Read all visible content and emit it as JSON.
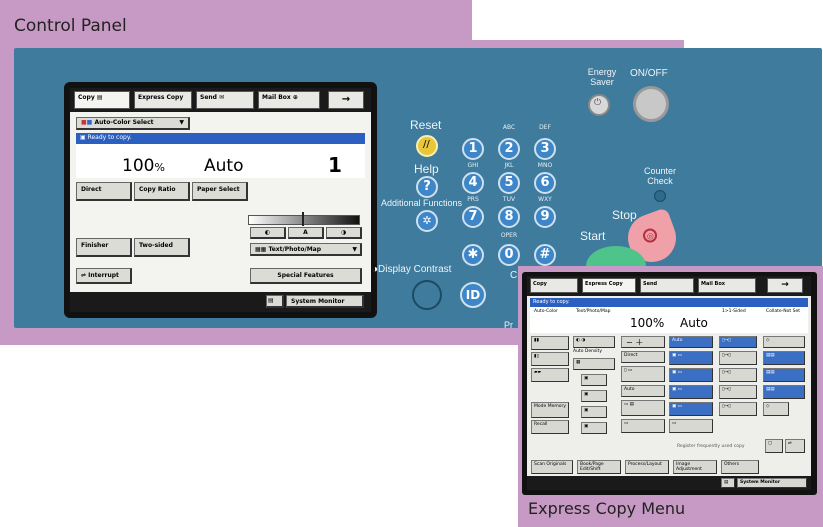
{
  "control_panel": {
    "title": "Control Panel",
    "lcd": {
      "tabs": [
        "Copy",
        "Express Copy",
        "Send",
        "Mail Box"
      ],
      "next_arrow": "→",
      "color_select": "Auto-Color Select",
      "status": "Ready to copy.",
      "ratio": "100",
      "ratio_unit": "%",
      "paper": "Auto",
      "copies": "1",
      "buttons": {
        "direct": "Direct",
        "copy_ratio": "Copy Ratio",
        "paper_select": "Paper Select",
        "finisher": "Finisher",
        "two_sided": "Two-sided",
        "interrupt": "Interrupt",
        "special_features": "Special Features",
        "system_monitor": "System Monitor"
      },
      "density_label": "A",
      "mode": "Text/Photo/Map"
    },
    "keys": {
      "reset": "Reset",
      "help": "Help",
      "help_symbol": "?",
      "additional_functions": "Additional Functions",
      "display_contrast": "Display Contrast",
      "digits": [
        "1",
        "2",
        "3",
        "4",
        "5",
        "6",
        "7",
        "8",
        "9",
        "0"
      ],
      "letters": [
        "ABC",
        "DEF",
        "GHI",
        "JKL",
        "MNO",
        "PRS",
        "TUV",
        "WXY",
        "OPER"
      ],
      "star": "✱",
      "hash": "#",
      "id": "ID",
      "energy_saver": "Energy Saver",
      "on_off": "ON/OFF",
      "counter_check": "Counter Check",
      "stop": "Stop",
      "start": "Start",
      "clear_partial": "C",
      "processing_partial": "Pr"
    }
  },
  "express_menu": {
    "title": "Express Copy Menu",
    "tabs": [
      "Copy",
      "Express Copy",
      "Send",
      "Mail Box"
    ],
    "next_arrow": "→",
    "status": "Ready to copy.",
    "headers": [
      "Auto-Color",
      "Text/Photo/Map",
      "100%",
      "Auto",
      "1>1-Sided",
      "Collate-Not Set"
    ],
    "labels": {
      "auto_density": "Auto Density",
      "direct": "Direct",
      "auto": "Auto",
      "rec_mem": "Recall",
      "mode_memory": "Mode Memory",
      "register": "Register frequently used copy",
      "others": "Others",
      "system_monitor": "System Monitor"
    },
    "bottom_buttons": [
      "Scan Originals",
      "Book/Page Edit/Shift",
      "Process/Layout",
      "Image Adjustment",
      "Others"
    ]
  },
  "colors": {
    "frame": "#c79ac6",
    "panel": "#3e7b9c",
    "key_blue": "#3d86c8",
    "reset_yellow": "#e8c63a",
    "stop_pink": "#f0a0a8",
    "start_green": "#4ec48a"
  }
}
